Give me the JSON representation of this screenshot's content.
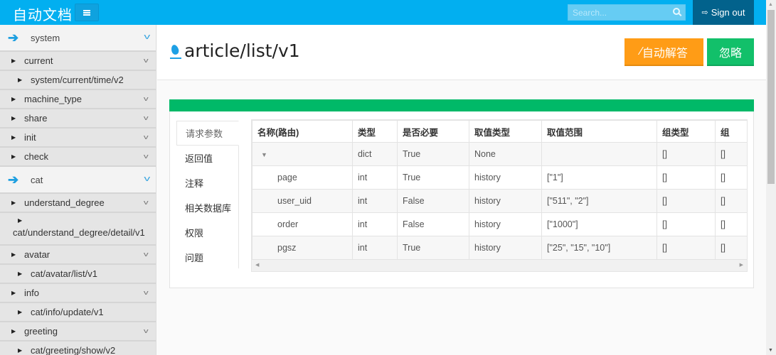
{
  "topbar": {
    "brand": "自动文档",
    "menu_icon": "hamburger-icon",
    "search_placeholder": "Search...",
    "search_icon": "search-icon",
    "signout_icon": "sign-out-icon",
    "signout_label": "Sign out"
  },
  "sidebar": {
    "groups": [
      {
        "label": "system",
        "items": [
          {
            "label": "current",
            "children": [
              "system/current/time/v2"
            ]
          },
          {
            "label": "machine_type",
            "children": []
          },
          {
            "label": "share",
            "children": []
          },
          {
            "label": "init",
            "children": []
          },
          {
            "label": "check",
            "children": []
          }
        ]
      },
      {
        "label": "cat",
        "items": [
          {
            "label": "understand_degree",
            "children": [
              "cat/understand_degree/detail/v1"
            ]
          },
          {
            "label": "avatar",
            "children": [
              "cat/avatar/list/v1"
            ]
          },
          {
            "label": "info",
            "children": [
              "cat/info/update/v1"
            ]
          },
          {
            "label": "greeting",
            "children": [
              "cat/greeting/show/v2"
            ]
          }
        ]
      }
    ]
  },
  "header": {
    "title": "article/list/v1",
    "auto_answer_label": "自动解答",
    "ignore_label": "忽略"
  },
  "tabs": [
    "请求参数",
    "返回值",
    "注释",
    "相关数据库",
    "权限",
    "问题"
  ],
  "active_tab": "请求参数",
  "table": {
    "columns": [
      "名称(路由)",
      "类型",
      "是否必要",
      "取值类型",
      "取值范围",
      "组类型",
      "组"
    ],
    "rows": [
      {
        "name": "▼",
        "type": "dict",
        "required": "True",
        "value_type": "None",
        "range": "",
        "group_type": "[]",
        "group": "[]"
      },
      {
        "name": "page",
        "type": "int",
        "required": "True",
        "value_type": "history",
        "range": "[\"1\"]",
        "group_type": "[]",
        "group": "[]"
      },
      {
        "name": "user_uid",
        "type": "int",
        "required": "False",
        "value_type": "history",
        "range": "[\"511\", \"2\"]",
        "group_type": "[]",
        "group": "[]"
      },
      {
        "name": "order",
        "type": "int",
        "required": "False",
        "value_type": "history",
        "range": "[\"1000\"]",
        "group_type": "[]",
        "group": "[]"
      },
      {
        "name": "pgsz",
        "type": "int",
        "required": "True",
        "value_type": "history",
        "range": "[\"25\", \"15\", \"10\"]",
        "group_type": "[]",
        "group": "[]"
      }
    ]
  },
  "colors": {
    "topbar": "#02aff0",
    "signout": "#02628c",
    "auto_answer": "#ff9c16",
    "ignore": "#12c06a",
    "panel_bar": "#00b968",
    "accent_arrow": "#1e9fe0"
  }
}
